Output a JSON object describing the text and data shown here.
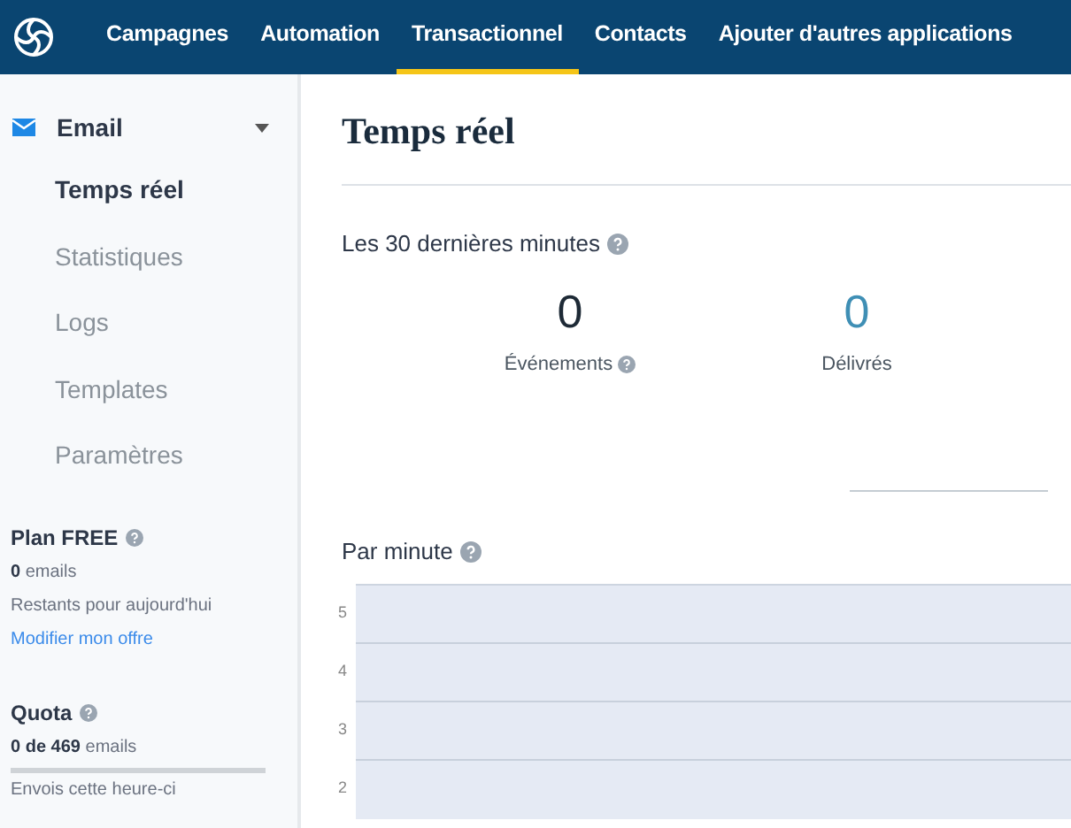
{
  "nav": {
    "items": [
      {
        "label": "Campagnes",
        "selected": false
      },
      {
        "label": "Automation",
        "selected": false
      },
      {
        "label": "Transactionnel",
        "selected": true
      },
      {
        "label": "Contacts",
        "selected": false
      },
      {
        "label": "Ajouter d'autres applications",
        "selected": false
      }
    ]
  },
  "sidebar": {
    "section": {
      "label": "Email",
      "expanded": true
    },
    "items": [
      {
        "label": "Temps réel",
        "selected": true
      },
      {
        "label": "Statistiques",
        "selected": false
      },
      {
        "label": "Logs",
        "selected": false
      },
      {
        "label": "Templates",
        "selected": false
      },
      {
        "label": "Paramètres",
        "selected": false
      }
    ],
    "plan": {
      "title": "Plan FREE",
      "count": "0",
      "unit": "emails",
      "caption": "Restants pour aujourd'hui",
      "link": "Modifier mon offre"
    },
    "quota": {
      "title": "Quota",
      "count": "0 de 469",
      "unit": "emails",
      "level": 0,
      "caption": "Envois cette heure-ci"
    }
  },
  "main": {
    "title": "Temps réel",
    "period": "Les 30 dernières minutes",
    "stats": [
      {
        "value": "0",
        "label": "Événements",
        "help": true,
        "kind": "dark"
      },
      {
        "value": "0",
        "label": "Délivrés",
        "help": false,
        "kind": "accent"
      }
    ],
    "chart": {
      "title": "Par minute",
      "yticks": [
        "5",
        "4",
        "3",
        "2"
      ]
    }
  }
}
